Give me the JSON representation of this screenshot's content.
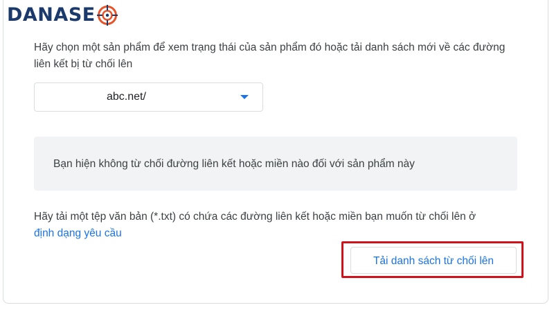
{
  "brand": {
    "logo_text_1": "DANA",
    "logo_text_2": "SE",
    "logo_icon": "target-o-icon",
    "color_dark": "#1b3a6b",
    "color_accent": "#e8542a"
  },
  "description": "Hãy chọn một sản phẩm để xem trạng thái của sản phẩm đó hoặc tải danh sách mới về các đường liên kết bị từ chối lên",
  "property_select": {
    "selected_value": "abc.net/",
    "caret_icon": "caret-down-icon"
  },
  "notice": {
    "text": "Bạn hiện không từ chối đường liên kết hoặc miền nào đối với sản phẩm này"
  },
  "upload": {
    "instruction": "Hãy tải một tệp văn bản (*.txt) có chứa các đường liên kết hoặc miền bạn muốn từ chối lên ở ",
    "format_link": "định dạng yêu cầu",
    "button_label": "Tải danh sách từ chối lên"
  },
  "colors": {
    "accent_blue": "#1a73e8",
    "highlight_red": "#d0121c",
    "notice_bg": "#f1f3f4"
  }
}
